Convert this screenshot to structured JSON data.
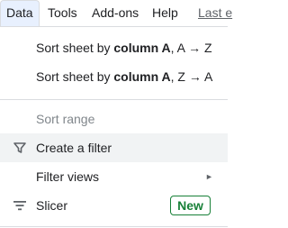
{
  "menubar": {
    "items": [
      {
        "label": "Data"
      },
      {
        "label": "Tools"
      },
      {
        "label": "Add-ons"
      },
      {
        "label": "Help"
      }
    ],
    "last_edit": "Last e"
  },
  "menu": {
    "sort_az": {
      "prefix": "Sort sheet by ",
      "column": "column A",
      "suffix": ", A → Z"
    },
    "sort_za": {
      "prefix": "Sort sheet by ",
      "column": "column A",
      "suffix": ", Z → A"
    },
    "sort_range": "Sort range",
    "create_filter": "Create a filter",
    "filter_views": "Filter views",
    "filter_views_arrow": "►",
    "slicer": "Slicer",
    "slicer_badge": "New"
  },
  "colors": {
    "accent_tab_bg": "#e8f0fe",
    "hover_bg": "#f1f3f4",
    "badge_green": "#188038",
    "disabled_text": "#80868b"
  },
  "icons": {
    "filter": "filter-funnel-icon",
    "slicer": "slicer-lines-icon"
  }
}
